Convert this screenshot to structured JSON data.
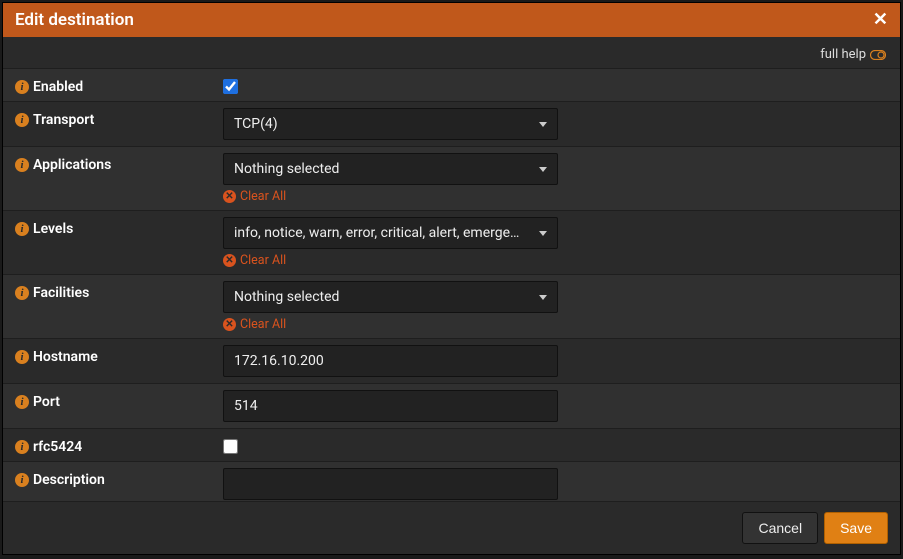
{
  "dialog": {
    "title": "Edit destination",
    "close_glyph": "✕"
  },
  "toolbar": {
    "full_help": "full help"
  },
  "fields": {
    "enabled": {
      "label": "Enabled",
      "checked": true
    },
    "transport": {
      "label": "Transport",
      "value": "TCP(4)"
    },
    "applications": {
      "label": "Applications",
      "value": "Nothing selected",
      "clear": "Clear All"
    },
    "levels": {
      "label": "Levels",
      "value": "info, notice, warn, error, critical, alert, emergency",
      "clear": "Clear All"
    },
    "facilities": {
      "label": "Facilities",
      "value": "Nothing selected",
      "clear": "Clear All"
    },
    "hostname": {
      "label": "Hostname",
      "value": "172.16.10.200"
    },
    "port": {
      "label": "Port",
      "value": "514"
    },
    "rfc5424": {
      "label": "rfc5424",
      "checked": false
    },
    "description": {
      "label": "Description",
      "value": ""
    }
  },
  "footer": {
    "cancel": "Cancel",
    "save": "Save"
  }
}
